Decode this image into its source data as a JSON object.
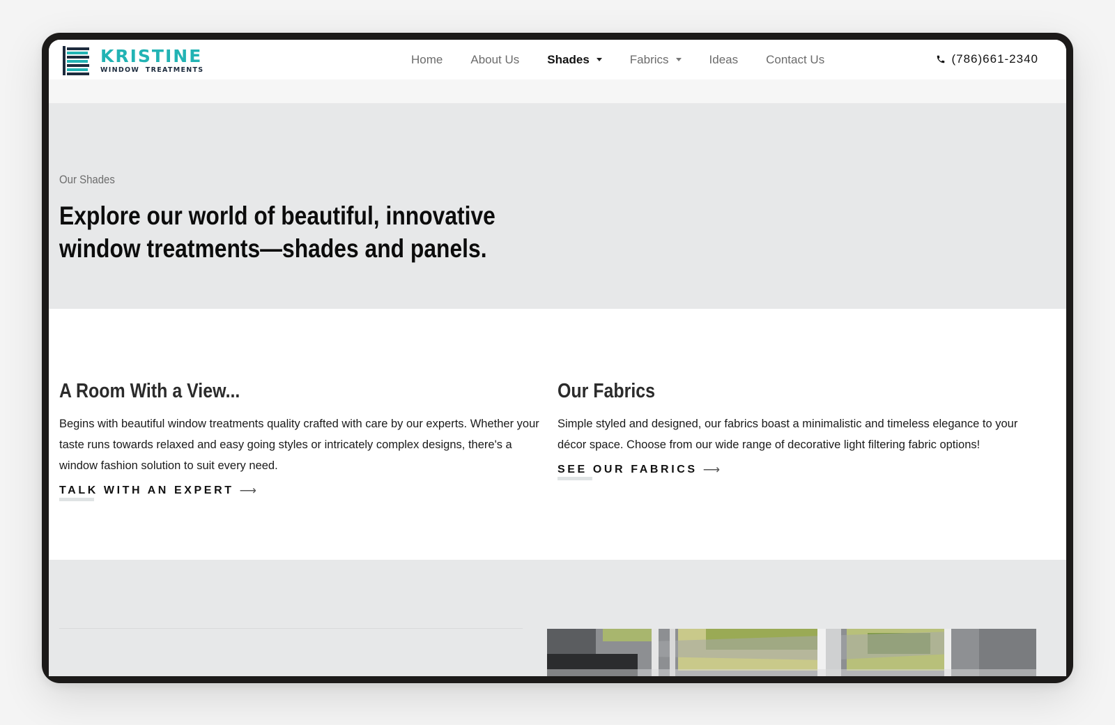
{
  "brand": {
    "name": "KRISTINE",
    "subtitle": "WINDOW TREATMENTS",
    "accent_color": "#22b3b4"
  },
  "nav": {
    "items": [
      {
        "label": "Home",
        "active": false,
        "has_dropdown": false
      },
      {
        "label": "About Us",
        "active": false,
        "has_dropdown": false
      },
      {
        "label": "Shades",
        "active": true,
        "has_dropdown": true
      },
      {
        "label": "Fabrics",
        "active": false,
        "has_dropdown": true
      },
      {
        "label": "Ideas",
        "active": false,
        "has_dropdown": false
      },
      {
        "label": "Contact Us",
        "active": false,
        "has_dropdown": false
      }
    ],
    "phone": "(786)661-2340",
    "phone_icon": "phone-icon"
  },
  "hero": {
    "eyebrow": "Our Shades",
    "title": "Explore our world of beautiful, innovative window treatments—shades and panels."
  },
  "features": {
    "left": {
      "title": "A Room With a View...",
      "body": "Begins with beautiful window treatments quality crafted with care by our experts. Whether your taste runs towards relaxed and easy going styles or intricately complex designs, there's a window fashion solution to suit every need.",
      "cta": "TALK WITH AN EXPERT",
      "cta_icon": "arrow-right-icon"
    },
    "right": {
      "title": "Our Fabrics",
      "body": "Simple styled and designed, our fabrics boast a minimalistic and timeless elegance to your décor space. Choose from our wide range of decorative light filtering fabric options!",
      "cta": "SEE OUR FABRICS",
      "cta_icon": "arrow-right-icon"
    }
  },
  "colors": {
    "hero_bg": "#e7e8e9",
    "frame": "#1c1a19"
  }
}
